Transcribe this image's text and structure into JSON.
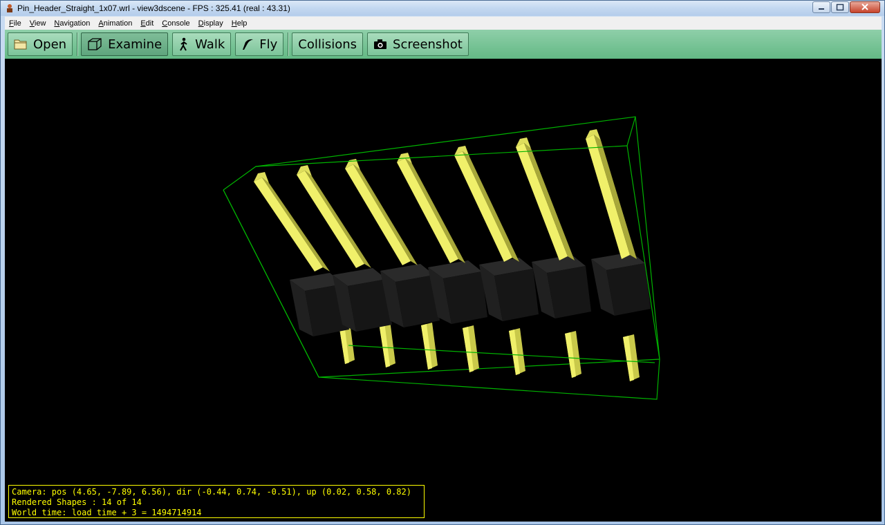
{
  "window": {
    "title": "Pin_Header_Straight_1x07.wrl - view3dscene - FPS : 325.41 (real : 43.31)"
  },
  "menu": [
    {
      "label": "File",
      "accel": "F",
      "rest": "ile"
    },
    {
      "label": "View",
      "accel": "V",
      "rest": "iew"
    },
    {
      "label": "Navigation",
      "accel": "N",
      "rest": "avigation"
    },
    {
      "label": "Animation",
      "accel": "A",
      "rest": "nimation"
    },
    {
      "label": "Edit",
      "accel": "E",
      "rest": "dit"
    },
    {
      "label": "Console",
      "accel": "C",
      "rest": "onsole"
    },
    {
      "label": "Display",
      "accel": "D",
      "rest": "isplay"
    },
    {
      "label": "Help",
      "accel": "H",
      "rest": "elp"
    }
  ],
  "toolbar": {
    "open": "Open",
    "examine": "Examine",
    "walk": "Walk",
    "fly": "Fly",
    "collisions": "Collisions",
    "screenshot": "Screenshot"
  },
  "status": {
    "camera": "Camera: pos (4.65, -7.89, 6.56), dir (-0.44, 0.74, -0.51), up (0.02, 0.58, 0.82)",
    "shapes": "Rendered Shapes : 14 of 14",
    "time": "World time: load time + 3 = 1494714914"
  },
  "colors": {
    "toolbar": "#7cc49a",
    "pin": "#f0f06a",
    "bbox": "#00b400",
    "status_text": "#ffff00"
  }
}
